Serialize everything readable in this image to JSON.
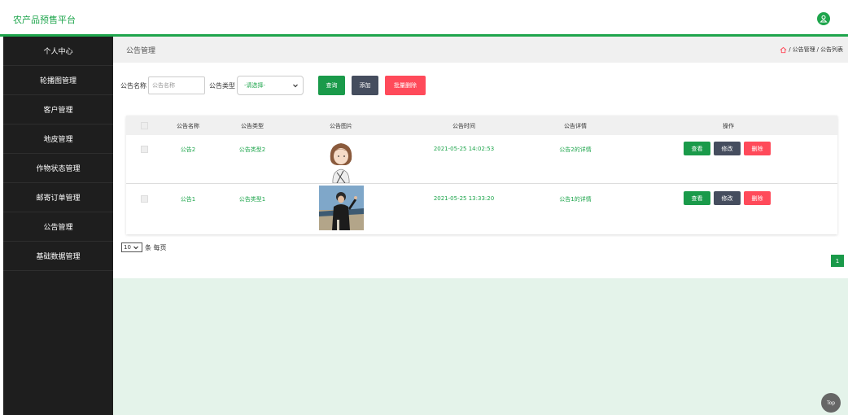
{
  "app": {
    "title": "农产品预售平台"
  },
  "sidebar": {
    "items": [
      {
        "label": "个人中心"
      },
      {
        "label": "轮播图管理"
      },
      {
        "label": "客户管理"
      },
      {
        "label": "地皮管理"
      },
      {
        "label": "作物状态管理"
      },
      {
        "label": "邮寄订单管理"
      },
      {
        "label": "公告管理"
      },
      {
        "label": "基础数据管理"
      }
    ]
  },
  "page": {
    "title": "公告管理"
  },
  "breadcrumb": {
    "section": "公告管理",
    "sep": "/",
    "current": "公告列表"
  },
  "search": {
    "name_label": "公告名称",
    "name_placeholder": "公告名称",
    "type_label": "公告类型",
    "type_value": "-请选择-",
    "query_btn": "查询",
    "add_btn": "添加",
    "batch_delete_btn": "批量删除"
  },
  "table": {
    "headers": [
      "公告名称",
      "公告类型",
      "公告图片",
      "公告时间",
      "公告详情",
      "操作"
    ],
    "rows": [
      {
        "name": "公告2",
        "type": "公告类型2",
        "time": "2021-05-25 14:02:53",
        "detail": "公告2的详情"
      },
      {
        "name": "公告1",
        "type": "公告类型1",
        "time": "2021-05-25 13:33:20",
        "detail": "公告1的详情"
      }
    ],
    "view_btn": "查看",
    "edit_btn": "修改",
    "delete_btn": "删除"
  },
  "pagination": {
    "page_size": "10",
    "per_page_label": "条 每页",
    "current_page": "1"
  },
  "back_to_top": "Top",
  "colors": {
    "accent": "#1ea54c",
    "danger": "#ff4a5a",
    "dark": "#454d5e"
  }
}
